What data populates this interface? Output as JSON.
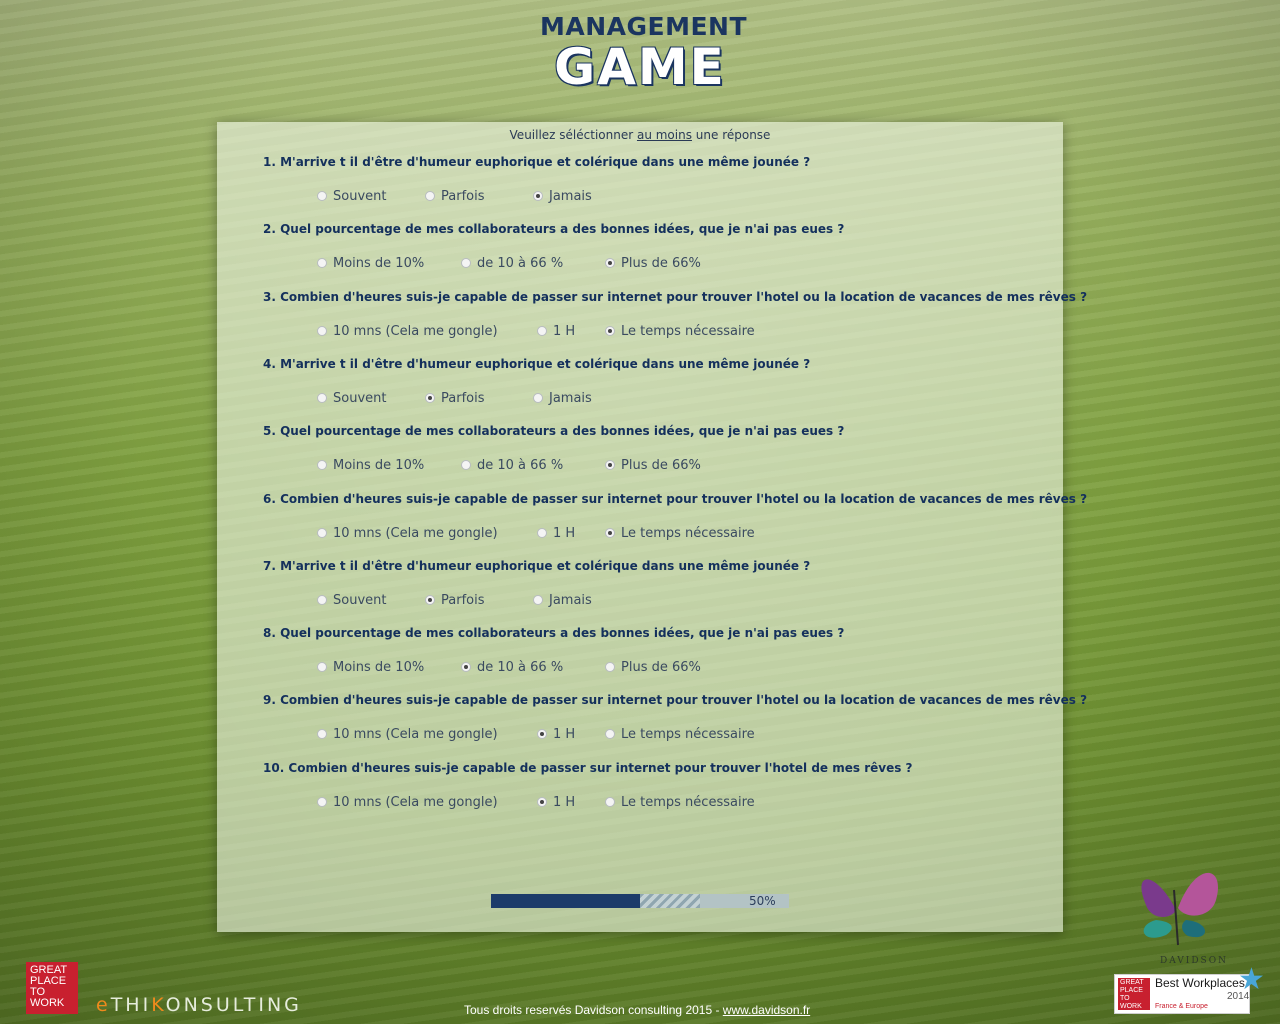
{
  "logo": {
    "line1": "MANAGEMENT",
    "line2": "GAME"
  },
  "instruction": {
    "before": "Veuillez séléctionner ",
    "underlined": "au moins",
    "after": " une réponse"
  },
  "questions": [
    {
      "text": "1. M'arrive t il d'être d'humeur euphorique et colérique dans une même jounée ?",
      "options": [
        {
          "label": "Souvent",
          "checked": false
        },
        {
          "label": "Parfois",
          "checked": false
        },
        {
          "label": "Jamais",
          "checked": true
        }
      ]
    },
    {
      "text": "2. Quel pourcentage de mes collaborateurs a des bonnes idées, que je n'ai pas eues ?",
      "options": [
        {
          "label": "Moins de 10%",
          "checked": false
        },
        {
          "label": "de 10 à 66 %",
          "checked": false
        },
        {
          "label": "Plus de 66%",
          "checked": true
        }
      ]
    },
    {
      "text": "3. Combien d'heures suis-je capable de passer sur internet pour trouver l'hotel ou la location de vacances de mes rêves ?",
      "options": [
        {
          "label": "10 mns (Cela me gongle)",
          "checked": false
        },
        {
          "label": "1 H",
          "checked": false
        },
        {
          "label": "Le temps nécessaire",
          "checked": true
        }
      ]
    },
    {
      "text": "4. M'arrive t il d'être d'humeur euphorique et colérique dans une même jounée ?",
      "options": [
        {
          "label": "Souvent",
          "checked": false
        },
        {
          "label": "Parfois",
          "checked": true
        },
        {
          "label": "Jamais",
          "checked": false
        }
      ]
    },
    {
      "text": "5. Quel pourcentage de mes collaborateurs a des bonnes idées, que je n'ai pas eues ?",
      "options": [
        {
          "label": "Moins de 10%",
          "checked": false
        },
        {
          "label": "de 10 à 66 %",
          "checked": false
        },
        {
          "label": "Plus de 66%",
          "checked": true
        }
      ]
    },
    {
      "text": "6. Combien d'heures suis-je capable de passer sur internet pour trouver l'hotel ou la location de vacances de mes rêves ?",
      "options": [
        {
          "label": "10 mns (Cela me gongle)",
          "checked": false
        },
        {
          "label": "1 H",
          "checked": false
        },
        {
          "label": "Le temps nécessaire",
          "checked": true
        }
      ]
    },
    {
      "text": "7. M'arrive t il d'être d'humeur euphorique et colérique dans une même jounée ?",
      "options": [
        {
          "label": "Souvent",
          "checked": false
        },
        {
          "label": "Parfois",
          "checked": true
        },
        {
          "label": "Jamais",
          "checked": false
        }
      ]
    },
    {
      "text": "8. Quel pourcentage de mes collaborateurs a des bonnes idées, que je n'ai pas eues ?",
      "options": [
        {
          "label": "Moins de 10%",
          "checked": false
        },
        {
          "label": "de 10 à 66 %",
          "checked": true
        },
        {
          "label": "Plus de 66%",
          "checked": false
        }
      ]
    },
    {
      "text": "9. Combien d'heures suis-je capable de passer sur internet pour trouver l'hotel ou la location de vacances de mes rêves ?",
      "options": [
        {
          "label": "10 mns (Cela me gongle)",
          "checked": false
        },
        {
          "label": "1 H",
          "checked": true
        },
        {
          "label": "Le temps nécessaire",
          "checked": false
        }
      ]
    },
    {
      "text": "10. Combien d'heures suis-je capable de passer sur internet pour trouver l'hotel  de mes rêves ?",
      "options": [
        {
          "label": "10 mns (Cela me gongle)",
          "checked": false
        },
        {
          "label": "1 H",
          "checked": true
        },
        {
          "label": "Le temps nécessaire",
          "checked": false
        }
      ]
    }
  ],
  "progress": {
    "value": 0.5,
    "striped_to": 0.7,
    "label": "50%"
  },
  "footer": {
    "gptw_logo_text": "GREAT PLACE TO WORK",
    "ethik_before": "e",
    "ethik_mid1": "THI",
    "ethik_k": "K",
    "ethik_after": "ONSULTING",
    "copyright_text": "Tous droits reservés Davidson consulting 2015 - ",
    "copyright_link": "www.davidson.fr",
    "davidson_word": "DAVIDSON",
    "badge_gptw": "GREAT PLACE TO WORK",
    "badge_best": "Best Workplaces",
    "badge_year": "2014",
    "badge_region": "France & Europe"
  },
  "colors": {
    "navy": "#14305c",
    "progress": "#1c3b6a",
    "gptw_red": "#c8202f",
    "ethik_orange": "#f08a1c"
  },
  "icons": [
    "radio-icon",
    "butterfly-icon",
    "star-icon"
  ]
}
